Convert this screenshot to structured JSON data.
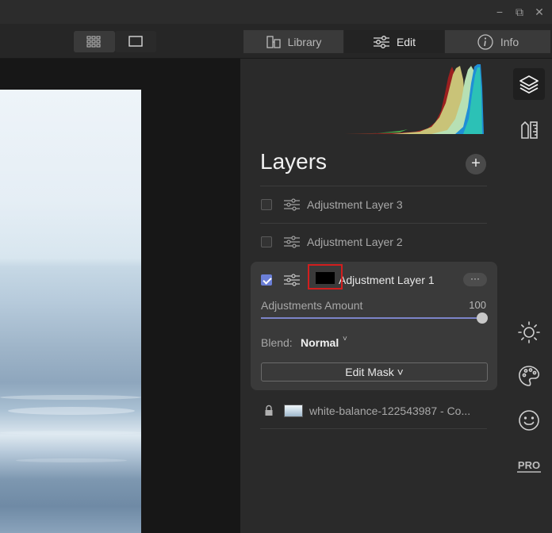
{
  "window": {
    "controls": {
      "minimize": "−",
      "restore": "⧉",
      "close": "✕"
    }
  },
  "toolbar": {
    "view_modes": [
      "grid-view-icon",
      "single-view-icon"
    ],
    "tabs": [
      {
        "label": "Library",
        "icon": "library-icon",
        "active": false
      },
      {
        "label": "Edit",
        "icon": "sliders-icon",
        "active": true
      },
      {
        "label": "Info",
        "icon": "info-icon",
        "active": false
      }
    ]
  },
  "panel": {
    "title": "Layers",
    "add_button": "+",
    "layers": [
      {
        "name": "Adjustment Layer 3",
        "checked": false
      },
      {
        "name": "Adjustment Layer 2",
        "checked": false
      },
      {
        "name": "Adjustment Layer 1",
        "checked": true,
        "active": true
      }
    ],
    "active_layer": {
      "more_label": "···",
      "amount_label": "Adjustments Amount",
      "amount_value": "100",
      "amount_fraction": 1.0,
      "blend_label": "Blend:",
      "blend_value": "Normal",
      "blend_caret": "˅",
      "edit_mask_label": "Edit Mask ˅"
    },
    "base_layer": {
      "name": "white-balance-122543987 - Co..."
    }
  },
  "rail": {
    "icons": [
      "layers-icon",
      "ruler-icon",
      "sun-icon",
      "palette-icon",
      "face-icon",
      "pro-badge"
    ],
    "pro_label": "PRO"
  },
  "colors": {
    "accent": "#6b7fd7",
    "highlight_border": "#d21e1e"
  }
}
